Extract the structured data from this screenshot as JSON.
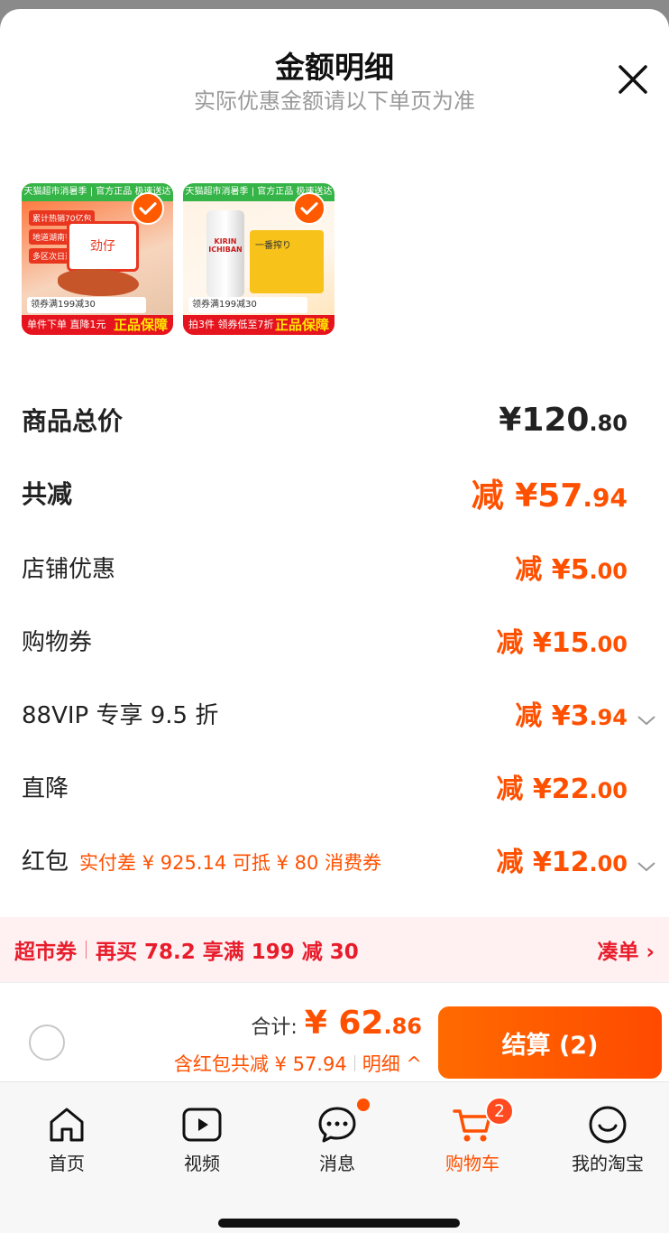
{
  "header": {
    "title": "金额明细",
    "subtitle": "实际优惠金额请以下单页为准"
  },
  "products": [
    {
      "top_banner": "天猫超市消暑季 | 官方正品 极速送达",
      "tags": [
        "累计热销70亿包",
        "地道湖南香辣",
        "多区次日达"
      ],
      "pack_label": "劲仔",
      "coupon": "领券满199减30",
      "promo": "单件下单 直降1元",
      "guarantee": "正品保障",
      "selected": true
    },
    {
      "top_banner": "天猫超市消暑季 | 官方正品 极速送达",
      "can_label": "KIRIN ICHIBAN",
      "box_label": "一番搾り",
      "coupon": "领券满199减30",
      "promo": "拍3件 领券低至7折",
      "guarantee": "正品保障",
      "selected": true
    }
  ],
  "summary": {
    "total_label": "商品总价",
    "total_int": "¥120",
    "total_dec": ".80",
    "reduce_label": "共减",
    "reduce_int": "减 ¥57",
    "reduce_dec": ".94"
  },
  "discounts": [
    {
      "label": "店铺优惠",
      "int": "减 ¥5",
      "dec": ".00"
    },
    {
      "label": "购物券",
      "int": "减 ¥15",
      "dec": ".00"
    },
    {
      "label": "88VIP 专享 9.5 折",
      "int": "减 ¥3",
      "dec": ".94"
    },
    {
      "label": "直降",
      "int": "减 ¥22",
      "dec": ".00"
    },
    {
      "label": "红包",
      "note": "实付差 ¥ 925.14 可抵 ¥ 80 消费券",
      "int": "减 ¥12",
      "dec": ".00"
    }
  ],
  "banner": {
    "tag": "超市券",
    "text": "再买 78.2 享满 199 减 30",
    "action": "凑单 ›"
  },
  "checkout": {
    "total_label": "合计:",
    "total_int": "¥ 62",
    "total_dec": ".86",
    "saving": "含红包共减 ¥ 57.94",
    "detail": "明细 ^",
    "pay_label": "结算 (2)"
  },
  "tabs": [
    {
      "label": "首页",
      "icon": "home-icon"
    },
    {
      "label": "视频",
      "icon": "video-icon"
    },
    {
      "label": "消息",
      "icon": "message-icon"
    },
    {
      "label": "购物车",
      "icon": "cart-icon",
      "badge": "2"
    },
    {
      "label": "我的淘宝",
      "icon": "profile-icon"
    }
  ],
  "colors": {
    "accent": "#ff5000",
    "banner_red": "#e81d2c",
    "banner_bg": "#fff0f2"
  }
}
